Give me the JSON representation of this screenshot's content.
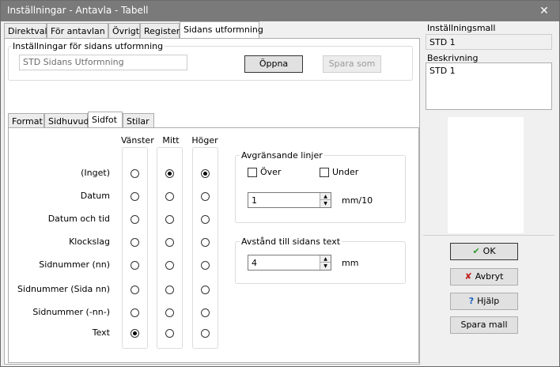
{
  "window": {
    "title": "Inställningar - Antavla - Tabell",
    "close_glyph": "✕"
  },
  "top_tabs": [
    "Direktval",
    "För antavlan",
    "Övrigt",
    "Register",
    "Sidans utformning"
  ],
  "settings_group": {
    "label": "Inställningar för sidans utformning",
    "value": "STD Sidans Utformning",
    "open_label": "Öppna",
    "save_as_label": "Spara som"
  },
  "inner_tabs": [
    "Format",
    "Sidhuvud",
    "Sidfot",
    "Stilar"
  ],
  "columns": [
    "Vänster",
    "Mitt",
    "Höger"
  ],
  "rows": [
    "(Inget)",
    "Datum",
    "Datum och tid",
    "Klockslag",
    "Sidnummer (nn)",
    "Sidnummer (Sida nn)",
    "Sidnummer (-nn-)",
    "Text"
  ],
  "selected": {
    "left": "Text",
    "middle": "(Inget)",
    "right": "(Inget)"
  },
  "separator_lines": {
    "label": "Avgränsande linjer",
    "over_label": "Över",
    "under_label": "Under",
    "over_checked": false,
    "under_checked": false,
    "value": "1",
    "unit": "mm/10"
  },
  "distance": {
    "label": "Avstånd till sidans text",
    "value": "4",
    "unit": "mm"
  },
  "template": {
    "label": "Inställningsmall",
    "value": "STD 1"
  },
  "description": {
    "label": "Beskrivning",
    "value": "STD 1"
  },
  "buttons": {
    "ok": "OK",
    "cancel": "Avbryt",
    "help": "Hjälp",
    "save_template": "Spara mall"
  },
  "colors": {
    "ok_icon": "#2e9a2e",
    "cancel_icon": "#c0201e",
    "help_icon": "#1a5fc0",
    "titlebar": "#7a7a7a"
  },
  "icons": {
    "ok": "checkmark-icon",
    "cancel": "x-icon",
    "help": "question-icon"
  }
}
